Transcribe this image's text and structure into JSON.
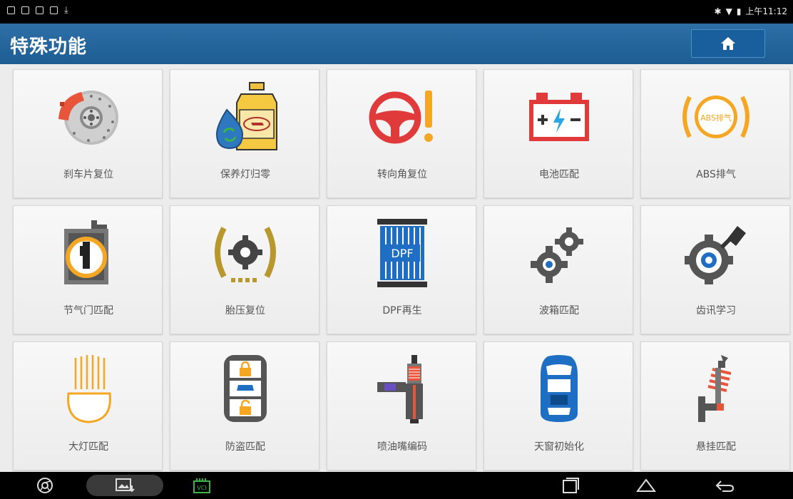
{
  "status": {
    "time": "上午11:12"
  },
  "header": {
    "title": "特殊功能"
  },
  "functions": [
    {
      "label": "刹车片复位"
    },
    {
      "label": "保养灯归零"
    },
    {
      "label": "转向角复位"
    },
    {
      "label": "电池匹配"
    },
    {
      "label": "ABS排气",
      "badge": "ABS排气"
    },
    {
      "label": "节气门匹配"
    },
    {
      "label": "胎压复位"
    },
    {
      "label": "DPF再生",
      "badge": "DPF"
    },
    {
      "label": "波箱匹配"
    },
    {
      "label": "齿讯学习"
    },
    {
      "label": "大灯匹配"
    },
    {
      "label": "防盗匹配"
    },
    {
      "label": "喷油嘴编码"
    },
    {
      "label": "天窗初始化"
    },
    {
      "label": "悬挂匹配"
    }
  ],
  "navbar": {
    "vci_label": "VCI"
  },
  "colors": {
    "header": "#2366a0",
    "accent_orange": "#f5a623",
    "icon_red": "#e03a3a",
    "icon_blue": "#1e6fc4"
  }
}
